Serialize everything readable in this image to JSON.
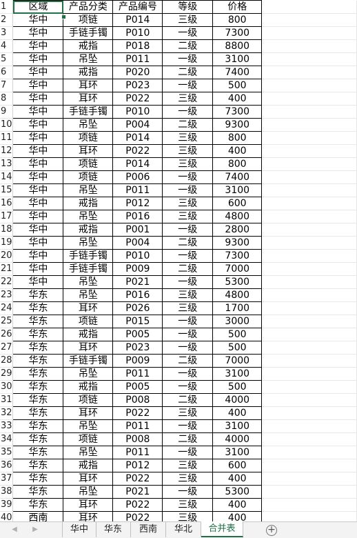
{
  "sheet": {
    "row_numbers": [
      "1",
      "2",
      "3",
      "4",
      "5",
      "6",
      "7",
      "8",
      "9",
      "10",
      "11",
      "12",
      "13",
      "14",
      "15",
      "16",
      "17",
      "18",
      "19",
      "20",
      "21",
      "22",
      "23",
      "24",
      "25",
      "26",
      "27",
      "28",
      "29",
      "30",
      "31",
      "32",
      "33",
      "34",
      "35",
      "36",
      "37",
      "38",
      "39",
      "40"
    ],
    "header": [
      "区域",
      "产品分类",
      "产品编号",
      "等级",
      "价格"
    ],
    "rows": [
      [
        "华中",
        "项链",
        "P014",
        "三级",
        "800"
      ],
      [
        "华中",
        "手链手镯",
        "P010",
        "一级",
        "7300"
      ],
      [
        "华中",
        "戒指",
        "P018",
        "二级",
        "8800"
      ],
      [
        "华中",
        "吊坠",
        "P011",
        "一级",
        "3100"
      ],
      [
        "华中",
        "戒指",
        "P020",
        "二级",
        "7400"
      ],
      [
        "华中",
        "耳环",
        "P023",
        "一级",
        "500"
      ],
      [
        "华中",
        "耳环",
        "P022",
        "三级",
        "400"
      ],
      [
        "华中",
        "手链手镯",
        "P010",
        "一级",
        "7300"
      ],
      [
        "华中",
        "吊坠",
        "P004",
        "二级",
        "9300"
      ],
      [
        "华中",
        "项链",
        "P014",
        "三级",
        "800"
      ],
      [
        "华中",
        "耳环",
        "P022",
        "三级",
        "400"
      ],
      [
        "华中",
        "项链",
        "P014",
        "三级",
        "800"
      ],
      [
        "华中",
        "项链",
        "P006",
        "一级",
        "7400"
      ],
      [
        "华中",
        "吊坠",
        "P011",
        "一级",
        "3100"
      ],
      [
        "华中",
        "戒指",
        "P012",
        "三级",
        "600"
      ],
      [
        "华中",
        "吊坠",
        "P016",
        "三级",
        "4800"
      ],
      [
        "华中",
        "戒指",
        "P001",
        "一级",
        "2800"
      ],
      [
        "华中",
        "吊坠",
        "P004",
        "二级",
        "9300"
      ],
      [
        "华中",
        "手链手镯",
        "P010",
        "一级",
        "7300"
      ],
      [
        "华中",
        "手链手镯",
        "P009",
        "二级",
        "7000"
      ],
      [
        "华中",
        "吊坠",
        "P021",
        "一级",
        "5300"
      ],
      [
        "华东",
        "吊坠",
        "P016",
        "三级",
        "4800"
      ],
      [
        "华东",
        "耳环",
        "P026",
        "三级",
        "1700"
      ],
      [
        "华东",
        "项链",
        "P015",
        "一级",
        "3000"
      ],
      [
        "华东",
        "戒指",
        "P005",
        "一级",
        "500"
      ],
      [
        "华东",
        "耳环",
        "P023",
        "一级",
        "500"
      ],
      [
        "华东",
        "手链手镯",
        "P009",
        "二级",
        "7000"
      ],
      [
        "华东",
        "吊坠",
        "P011",
        "一级",
        "3100"
      ],
      [
        "华东",
        "戒指",
        "P005",
        "一级",
        "500"
      ],
      [
        "华东",
        "项链",
        "P008",
        "二级",
        "4000"
      ],
      [
        "华东",
        "耳环",
        "P022",
        "三级",
        "400"
      ],
      [
        "华东",
        "吊坠",
        "P011",
        "一级",
        "3100"
      ],
      [
        "华东",
        "项链",
        "P008",
        "二级",
        "4000"
      ],
      [
        "华东",
        "吊坠",
        "P011",
        "一级",
        "3100"
      ],
      [
        "华东",
        "戒指",
        "P012",
        "三级",
        "600"
      ],
      [
        "华东",
        "耳环",
        "P022",
        "三级",
        "400"
      ],
      [
        "华东",
        "吊坠",
        "P021",
        "一级",
        "5300"
      ],
      [
        "华东",
        "耳环",
        "P022",
        "三级",
        "400"
      ],
      [
        "西南",
        "耳环",
        "P022",
        "三级",
        "400"
      ]
    ]
  },
  "tabs": [
    {
      "label": "华中",
      "active": false
    },
    {
      "label": "华东",
      "active": false
    },
    {
      "label": "西南",
      "active": false
    },
    {
      "label": "华北",
      "active": false
    },
    {
      "label": "合并表",
      "active": true
    }
  ],
  "icons": {
    "prev": "chevron-left-icon",
    "next": "chevron-right-icon",
    "add": "plus-circle-icon"
  },
  "colors": {
    "accent": "#1e7145",
    "grid": "#000000",
    "tabbar_bg": "#f3f3f3"
  }
}
